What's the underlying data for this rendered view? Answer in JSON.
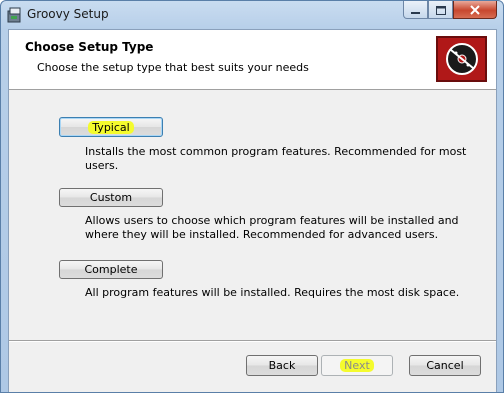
{
  "window": {
    "title": "Groovy Setup",
    "icons": {
      "app": "installer-icon",
      "minimize": "minimize-icon",
      "maximize": "maximize-icon",
      "close": "close-icon"
    }
  },
  "banner": {
    "title": "Choose Setup Type",
    "subtitle": "Choose the setup type that best suits your needs",
    "logo_icon": "disc-icon"
  },
  "options": [
    {
      "label": "Typical",
      "description": "Installs the most common program features. Recommended for most users.",
      "highlighted": true
    },
    {
      "label": "Custom",
      "description": "Allows users to choose which program features will be installed and where they will be installed. Recommended for advanced users.",
      "highlighted": false
    },
    {
      "label": "Complete",
      "description": "All program features will be installed. Requires the most disk space.",
      "highlighted": false
    }
  ],
  "footer": {
    "back_label": "Back",
    "next_label": "Next",
    "cancel_label": "Cancel"
  },
  "colors": {
    "highlight": "#f4fb2e",
    "logo_red": "#b01818"
  }
}
